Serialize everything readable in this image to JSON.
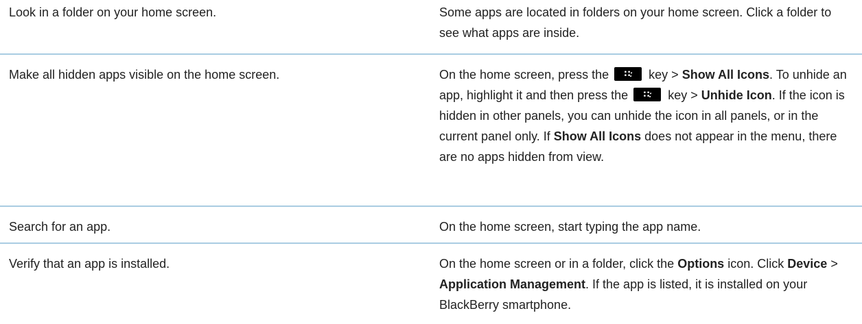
{
  "rows": [
    {
      "task": "Look in a folder on your home screen.",
      "detail_1": "Some apps are located in folders on your home screen. Click a folder to see what apps are inside."
    },
    {
      "task": "Make all hidden apps visible on the home screen.",
      "d_a": "On the home screen, press the",
      "key_icon": "blackberry-menu-key-icon",
      "d_b": "key >",
      "d_c": "Show All Icons",
      "d_d": ". To unhide an app, highlight it and then press the",
      "d_e": "key >",
      "d_f": "Unhide Icon",
      "d_g": ". If the icon is hidden in other panels, you can unhide the icon in all panels, or in the current panel only. If",
      "d_h": "Show All Icons",
      "d_i": "does not appear in the menu, there are no apps hidden from view."
    },
    {
      "task": "Search for an app.",
      "detail_1": "On the home screen, start typing the app name."
    },
    {
      "task": "Verify that an app is installed.",
      "d_a": "On the home screen or in a folder, click the",
      "d_b": "Options",
      "d_c": "icon. Click",
      "d_d": "Device",
      "d_e": ">",
      "d_f": "Application Management",
      "d_g": ". If the app is listed, it is installed on your BlackBerry smartphone."
    }
  ],
  "colors": {
    "divider": "#a9cce2",
    "text": "#222222"
  }
}
